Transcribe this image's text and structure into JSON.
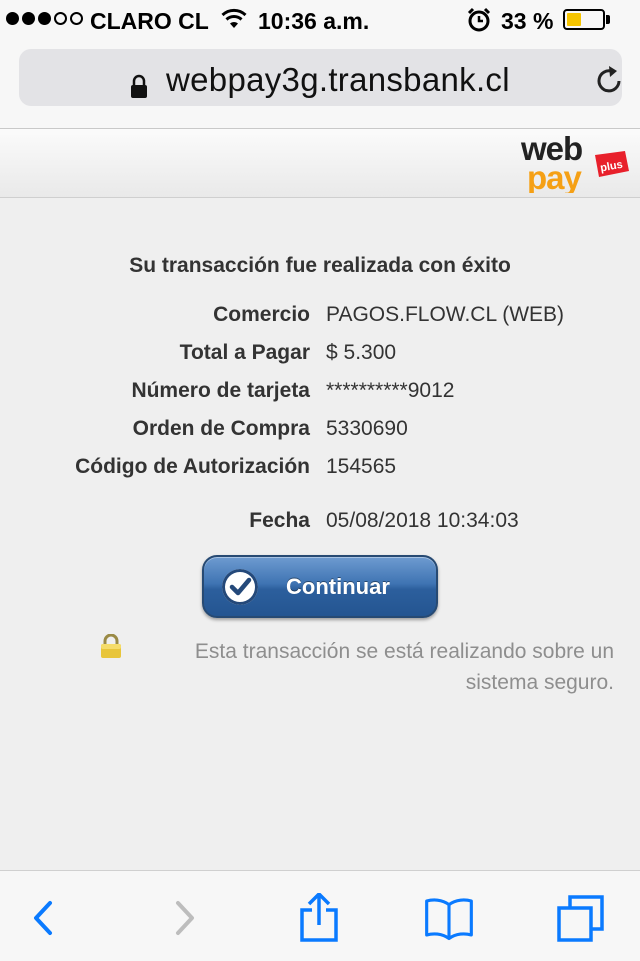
{
  "status_bar": {
    "carrier": "CLARO CL",
    "time": "10:36 a.m.",
    "battery_percent": "33 %",
    "battery_level": 0.33,
    "signal_bars_filled": 3,
    "signal_bars_total": 5,
    "battery_color": "#f5c400",
    "icons": [
      "wifi-icon",
      "alarm-icon",
      "battery-icon"
    ]
  },
  "address_bar": {
    "url": "webpay3g.transbank.cl",
    "icons": [
      "lock-icon",
      "reload-icon"
    ]
  },
  "header": {
    "logo_web": "web",
    "logo_pay": "pay",
    "logo_plus": "plus"
  },
  "receipt": {
    "title": "Su transacción fue realizada con éxito",
    "rows": [
      {
        "label": "Comercio",
        "value": "PAGOS.FLOW.CL (WEB)"
      },
      {
        "label": "Total a Pagar",
        "value": "$ 5.300"
      },
      {
        "label": "Número de tarjeta",
        "value": "**********9012"
      },
      {
        "label": "Orden de Compra",
        "value": "5330690"
      },
      {
        "label": "Código de Autorización",
        "value": "154565"
      },
      {
        "label": "Fecha",
        "value": "05/08/2018 10:34:03"
      }
    ],
    "continue_label": "Continuar",
    "secure_line1": "Esta transacción se está realizando sobre un",
    "secure_line2": "sistema seguro."
  },
  "toolbar": {
    "items": [
      "back-icon",
      "forward-icon",
      "share-icon",
      "bookmarks-icon",
      "tabs-icon"
    ],
    "accent": "#0a7aff",
    "disabled": "#bdbdbd"
  }
}
